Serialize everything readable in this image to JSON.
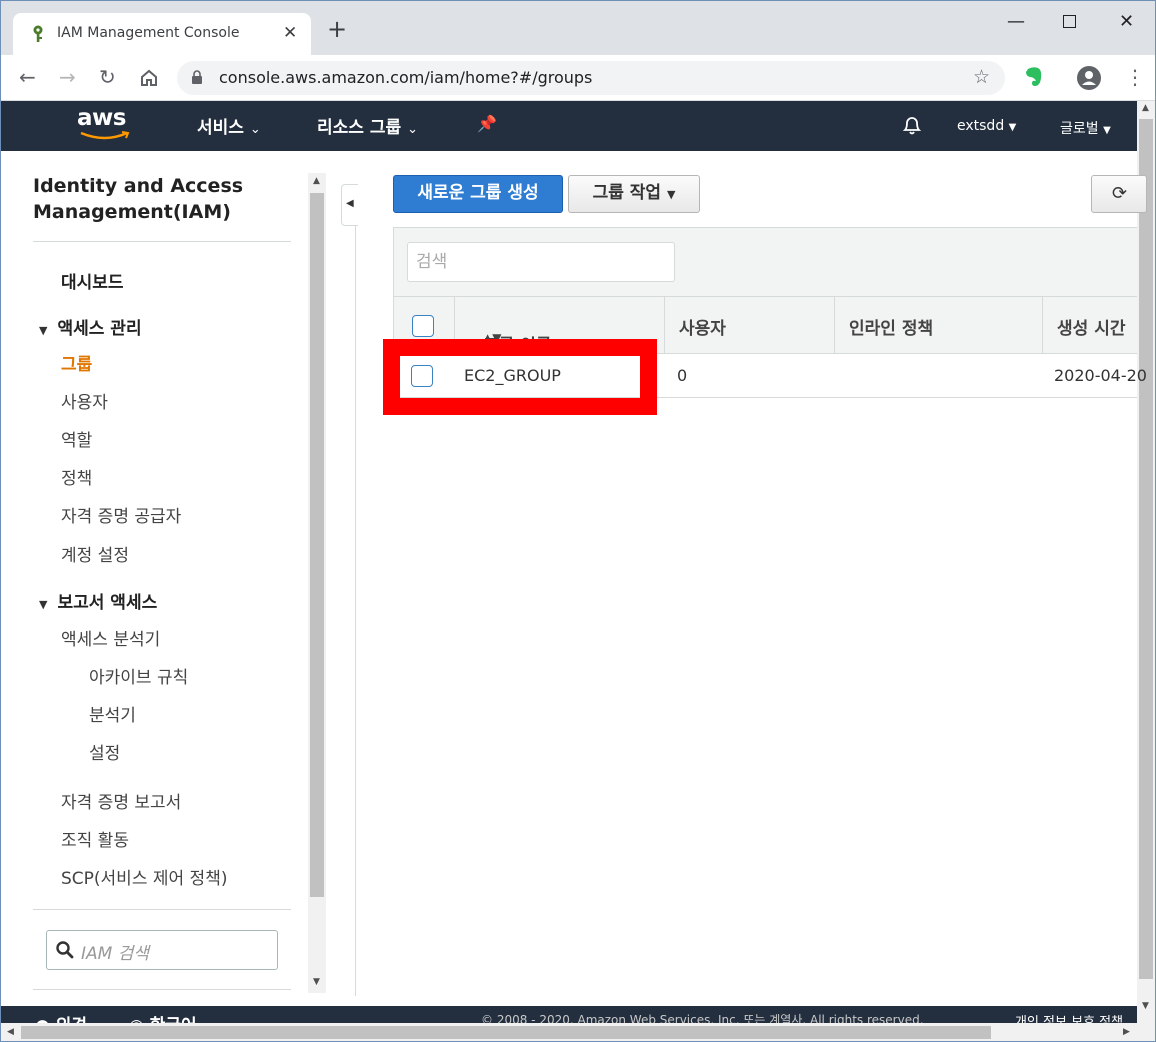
{
  "browser": {
    "tab_title": "IAM Management Console",
    "url": "console.aws.amazon.com/iam/home?#/groups"
  },
  "nav": {
    "services": "서비스",
    "resource_groups": "리소스 그룹",
    "account": "extsdd",
    "region": "글로벌"
  },
  "sidebar": {
    "title": "Identity and Access Management(IAM)",
    "dashboard": "대시보드",
    "access_mgmt": "액세스 관리",
    "groups": "그룹",
    "users": "사용자",
    "roles": "역할",
    "policies": "정책",
    "identity_providers": "자격 증명 공급자",
    "account_settings": "계정 설정",
    "reports_access": "보고서 액세스",
    "access_analyzer": "액세스 분석기",
    "archive_rules": "아카이브 규칙",
    "analyzers": "분석기",
    "settings": "설정",
    "credential_report": "자격 증명 보고서",
    "org_activity": "조직 활동",
    "scp": "SCP(서비스 제어 정책)",
    "search_placeholder": "IAM 검색"
  },
  "main": {
    "create_group": "새로운 그룹 생성",
    "group_actions": "그룹 작업",
    "filter_placeholder": "검색",
    "columns": {
      "group_name": "그룹 이름",
      "users": "사용자",
      "inline_policy": "인라인 정책",
      "created": "생성 시간"
    },
    "rows": [
      {
        "name": "EC2_GROUP",
        "users": "0",
        "inline_policy": "",
        "created": "2020-04-20"
      }
    ]
  },
  "footer": {
    "feedback": "의견",
    "language": "한국어",
    "copyright": "© 2008 - 2020, Amazon Web Services, Inc. 또는 계열사. All rights reserved.",
    "privacy": "개인 정보 보호 정책"
  },
  "colors": {
    "aws_nav": "#232f3e",
    "primary_button": "#2f7dd3",
    "active_link": "#e07700",
    "highlight": "#ff0000"
  }
}
